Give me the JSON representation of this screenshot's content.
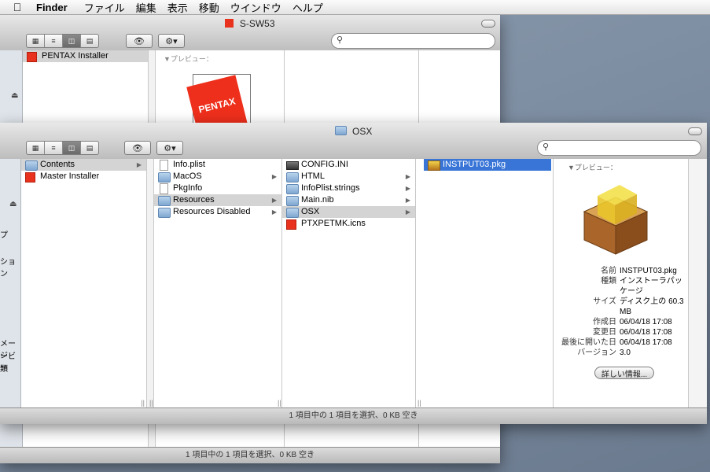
{
  "menubar": {
    "app_name": "Finder",
    "items": [
      "ファイル",
      "編集",
      "表示",
      "移動",
      "ウインドウ",
      "ヘルプ"
    ]
  },
  "back_window": {
    "title": "S-SW53",
    "column1": [
      "PENTAX Installer"
    ],
    "preview_label": "▼プレビュー：",
    "logo_text": "PENTAX",
    "status": "1 項目中の 1 項目を選択、0 KB 空き"
  },
  "front_window": {
    "title": "OSX",
    "sidebar_fragments": [
      "プ",
      "ション",
      "メージ",
      "ービー",
      "類"
    ],
    "col1": [
      {
        "label": "Contents",
        "icon": "folder-icon",
        "arrow": true
      },
      {
        "label": "Master Installer",
        "icon": "pentax-installer-icon",
        "arrow": false
      }
    ],
    "col2": [
      {
        "label": "Info.plist",
        "icon": "document-icon",
        "arrow": false
      },
      {
        "label": "MacOS",
        "icon": "folder-icon",
        "arrow": true
      },
      {
        "label": "PkgInfo",
        "icon": "document-icon",
        "arrow": false
      },
      {
        "label": "Resources",
        "icon": "folder-icon",
        "arrow": true
      },
      {
        "label": "Resources Disabled",
        "icon": "folder-icon",
        "arrow": true
      }
    ],
    "col3": [
      {
        "label": "CONFIG.INI",
        "icon": "ini-file-icon",
        "arrow": false
      },
      {
        "label": "HTML",
        "icon": "folder-icon",
        "arrow": true
      },
      {
        "label": "InfoPlist.strings",
        "icon": "folder-icon",
        "arrow": true
      },
      {
        "label": "Main.nib",
        "icon": "folder-icon",
        "arrow": true
      },
      {
        "label": "OSX",
        "icon": "folder-icon",
        "arrow": true
      },
      {
        "label": "PTXPETMK.icns",
        "icon": "icns-file-icon",
        "arrow": false
      }
    ],
    "col4": [
      {
        "label": "INSTPUT03.pkg",
        "icon": "package-icon",
        "arrow": false
      }
    ],
    "preview": {
      "label": "▼プレビュー：",
      "info": [
        {
          "k": "名前",
          "v": "INSTPUT03.pkg"
        },
        {
          "k": "種類",
          "v": "インストーラパッケージ"
        },
        {
          "k": "サイズ",
          "v": "ディスク上の 60.3 MB"
        },
        {
          "k": "作成日",
          "v": "06/04/18 17:08"
        },
        {
          "k": "変更日",
          "v": "06/04/18 17:08"
        },
        {
          "k": "最後に開いた日",
          "v": "06/04/18 17:08"
        },
        {
          "k": "バージョン",
          "v": "3.0"
        }
      ],
      "more_button": "詳しい情報..."
    },
    "status": "1 項目中の 1 項目を選択、0 KB 空き"
  },
  "colors": {
    "selection": "#3875d7",
    "pentax_red": "#e8321e",
    "desktop": "#7f8fa3"
  }
}
